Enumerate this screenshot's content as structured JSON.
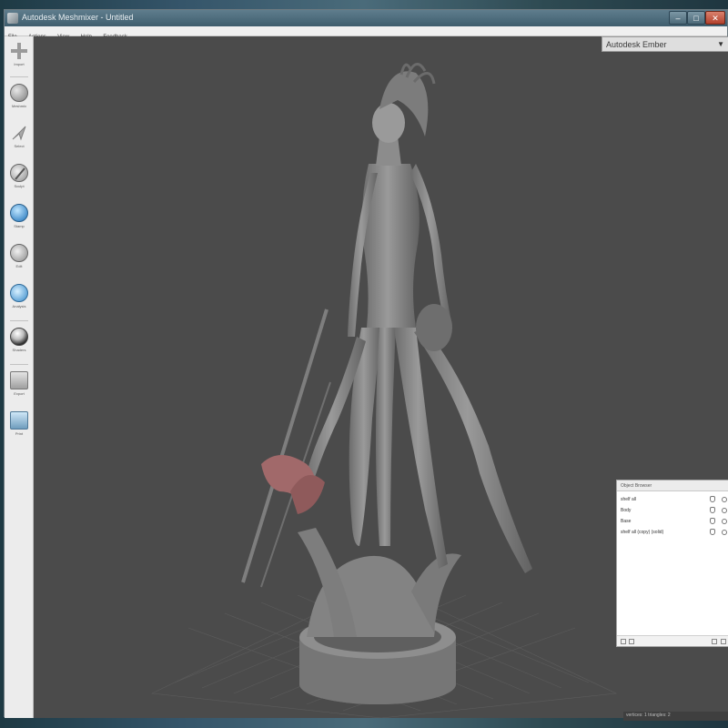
{
  "window": {
    "title": "Autodesk Meshmixer - Untitled",
    "controls": [
      "–",
      "□",
      "✕"
    ]
  },
  "menubar": {
    "items": [
      "File",
      "Actions",
      "View",
      "Help",
      "Feedback"
    ]
  },
  "toolbar": {
    "tools": [
      {
        "label": "Import",
        "icon": "plus-icon"
      },
      {
        "label": "Meshmix",
        "icon": "meshmix-icon"
      },
      {
        "label": "Select",
        "icon": "select-arrow-icon"
      },
      {
        "label": "Sculpt",
        "icon": "brush-icon"
      },
      {
        "label": "Stamp",
        "icon": "stamp-icon"
      },
      {
        "label": "Edit",
        "icon": "edit-icon"
      },
      {
        "label": "Analysis",
        "icon": "analysis-icon"
      },
      {
        "label": "Shaders",
        "icon": "shader-sphere-icon"
      },
      {
        "label": "Export",
        "icon": "export-icon"
      },
      {
        "label": "Print",
        "icon": "print-icon"
      }
    ]
  },
  "ember": {
    "title": "Autodesk Ember",
    "arrow": "▼"
  },
  "object_browser": {
    "title": "Object Browser",
    "objects": [
      "shelf all",
      "Body",
      "Base",
      "shelf all (copy) (solid)"
    ]
  },
  "status": {
    "text": "vertices: 1 triangles: 2"
  },
  "colors": {
    "viewport_bg": "#4b4b4b",
    "model": "#8a8a8a",
    "selected_part": "#a1696a",
    "titlebar": "#4f6e7e"
  }
}
